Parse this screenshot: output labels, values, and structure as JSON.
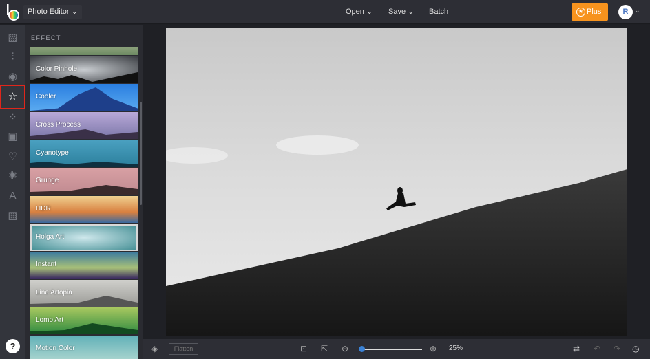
{
  "header": {
    "app_title": "Photo Editor",
    "menu": [
      "Open",
      "Save",
      "Batch"
    ],
    "plus_label": "Plus",
    "avatar_initial": "R"
  },
  "rail": {
    "icons": [
      "image-icon",
      "sliders-icon",
      "eye-icon",
      "star-icon",
      "nodes-icon",
      "frame-icon",
      "heart-icon",
      "badge-icon",
      "text-icon",
      "texture-icon"
    ],
    "active": "star-icon",
    "help": "?"
  },
  "panel": {
    "heading": "EFFECT",
    "effects": [
      "Color Pinhole",
      "Cooler",
      "Cross Process",
      "Cyanotype",
      "Grunge",
      "HDR",
      "Holga Art",
      "Instant",
      "Line Artopia",
      "Lomo Art",
      "Motion Color"
    ],
    "selected": "Holga Art"
  },
  "bottom": {
    "flatten": "Flatten",
    "zoom": "25%",
    "zoom_value": 25
  },
  "colors": {
    "accent": "#f7931e",
    "active_border": "#e0261b",
    "slider": "#3b82d6"
  }
}
